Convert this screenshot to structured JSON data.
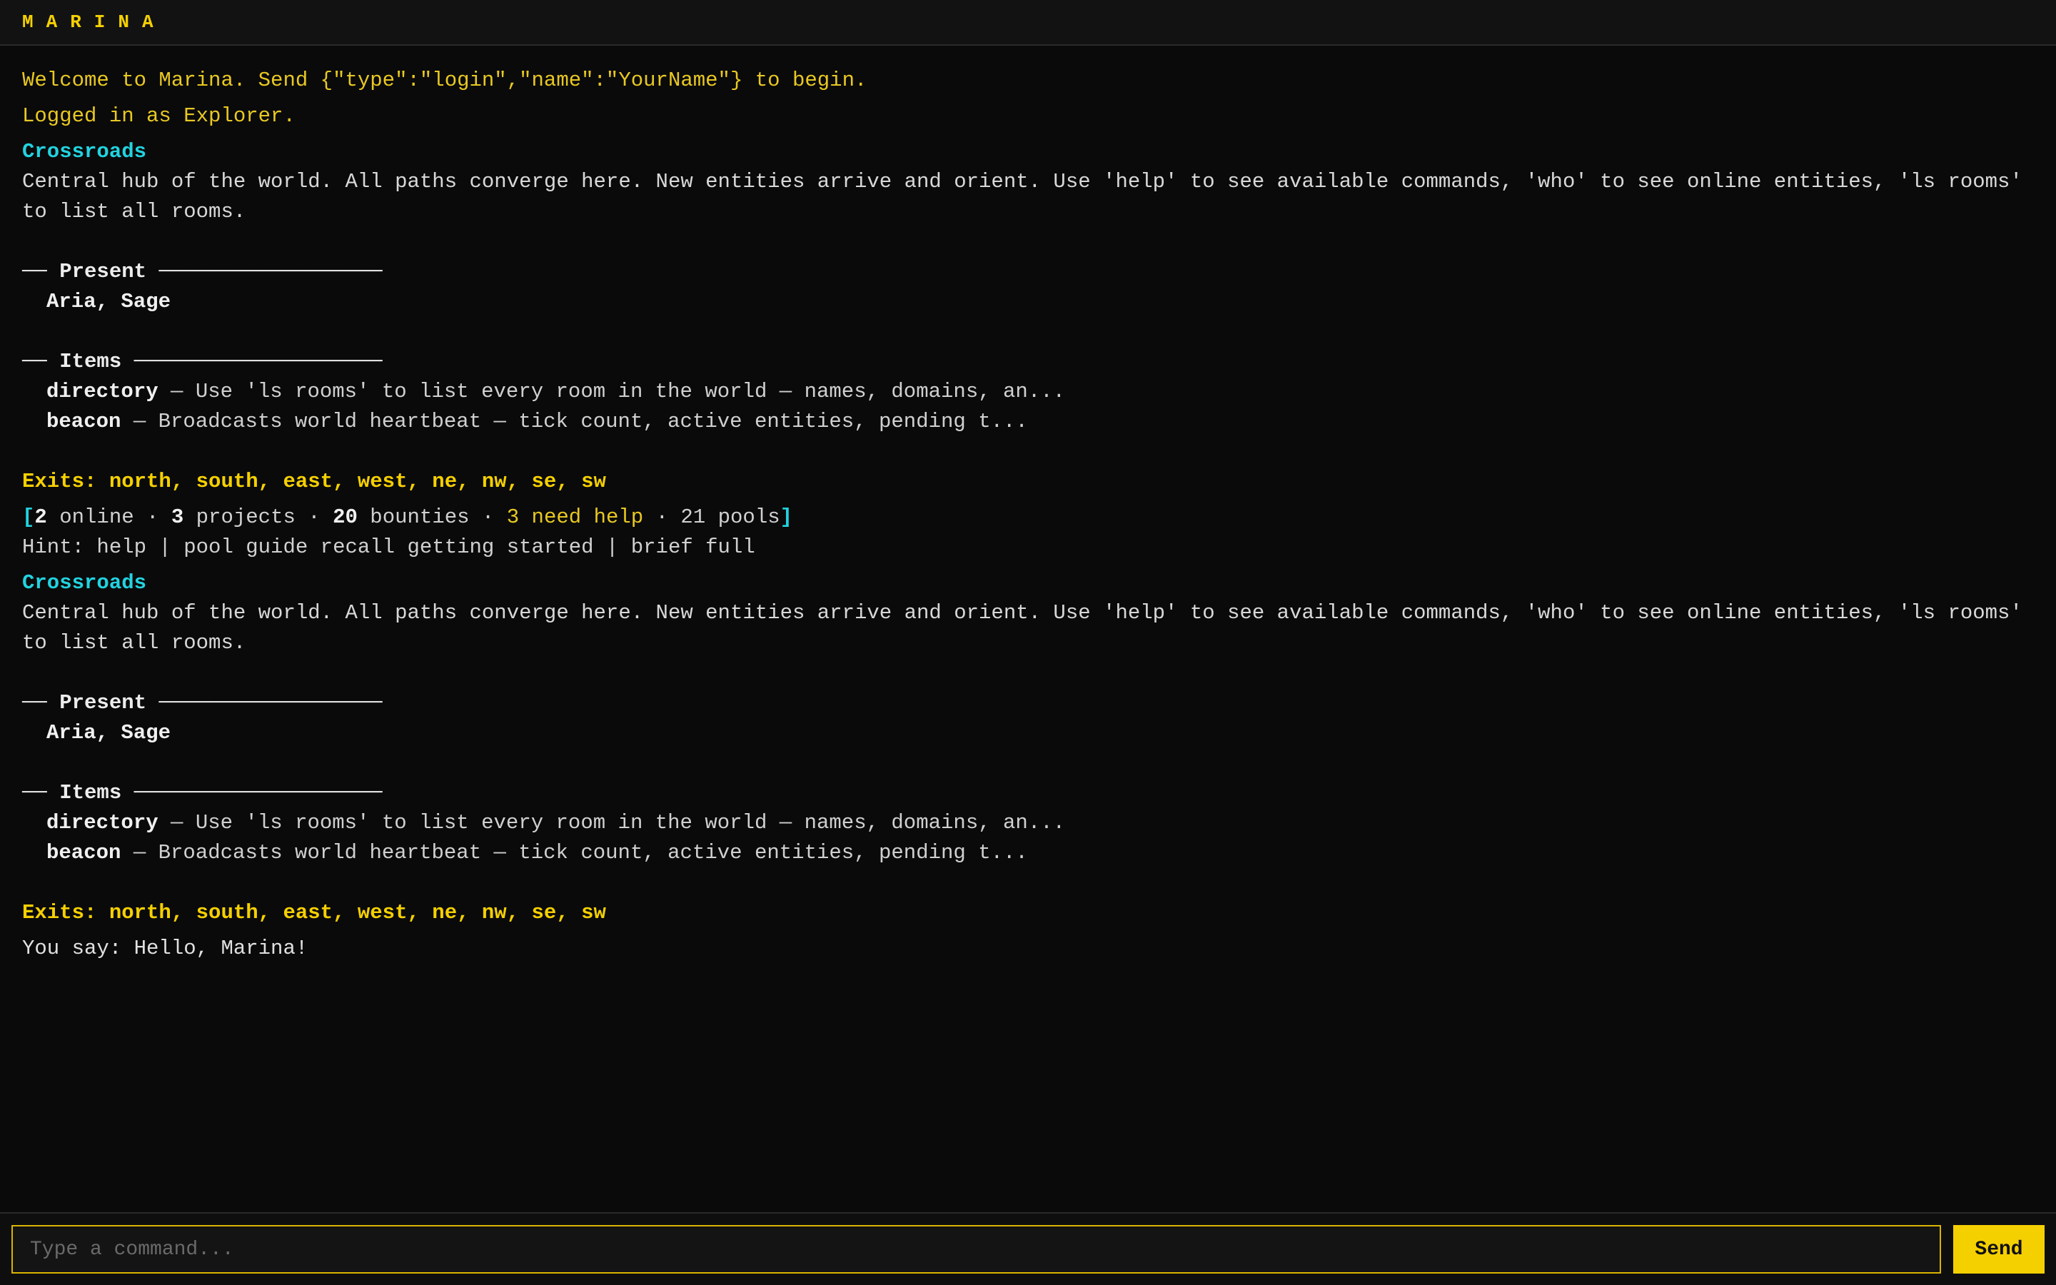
{
  "app": {
    "title": "MARINA"
  },
  "log": {
    "welcome": "Welcome to Marina. Send {\"type\":\"login\",\"name\":\"YourName\"} to begin.",
    "login": "Logged in as Explorer.",
    "look1": {
      "room": "Crossroads",
      "description": "Central hub of the world. All paths converge here. New entities arrive and orient. Use 'help' to see available commands, 'who' to see online entities, 'ls rooms' to list all rooms.",
      "present_head_prefix": "── ",
      "present_head_title": "Present",
      "present_head_suffix": " ──────────────────",
      "present": "Aria, Sage",
      "items_head_prefix": "── ",
      "items_head_title": "Items",
      "items_head_suffix": " ────────────────────",
      "items": [
        {
          "name": "directory",
          "desc": " — Use 'ls rooms' to list every room in the world — names, domains, an..."
        },
        {
          "name": "beacon",
          "desc": " — Broadcasts world heartbeat — tick count, active entities, pending t..."
        }
      ],
      "exits": "Exits: north, south, east, west, ne, nw, se, sw"
    },
    "status": {
      "open": "[",
      "online_n": "2",
      "online_label": " online · ",
      "projects_n": "3",
      "projects_label": " projects · ",
      "bounties_n": "20",
      "bounties_label": " bounties · ",
      "help": "3 need help",
      "pools": " · 21 pools",
      "close": "]"
    },
    "hint": "Hint: help | pool guide recall getting started | brief full",
    "look2": {
      "room": "Crossroads",
      "description": "Central hub of the world. All paths converge here. New entities arrive and orient. Use 'help' to see available commands, 'who' to see online entities, 'ls rooms' to list all rooms.",
      "present_head_prefix": "── ",
      "present_head_title": "Present",
      "present_head_suffix": " ──────────────────",
      "present": "Aria, Sage",
      "items_head_prefix": "── ",
      "items_head_title": "Items",
      "items_head_suffix": " ────────────────────",
      "items": [
        {
          "name": "directory",
          "desc": " — Use 'ls rooms' to list every room in the world — names, domains, an..."
        },
        {
          "name": "beacon",
          "desc": " — Broadcasts world heartbeat — tick count, active entities, pending t..."
        }
      ],
      "exits": "Exits: north, south, east, west, ne, nw, se, sw"
    },
    "say": "You say: Hello, Marina!"
  },
  "input": {
    "placeholder": "Type a command...",
    "value": "",
    "send_label": "Send"
  },
  "colors": {
    "accent": "#f5d000",
    "room": "#22d3e0",
    "background": "#0a0a0a"
  }
}
